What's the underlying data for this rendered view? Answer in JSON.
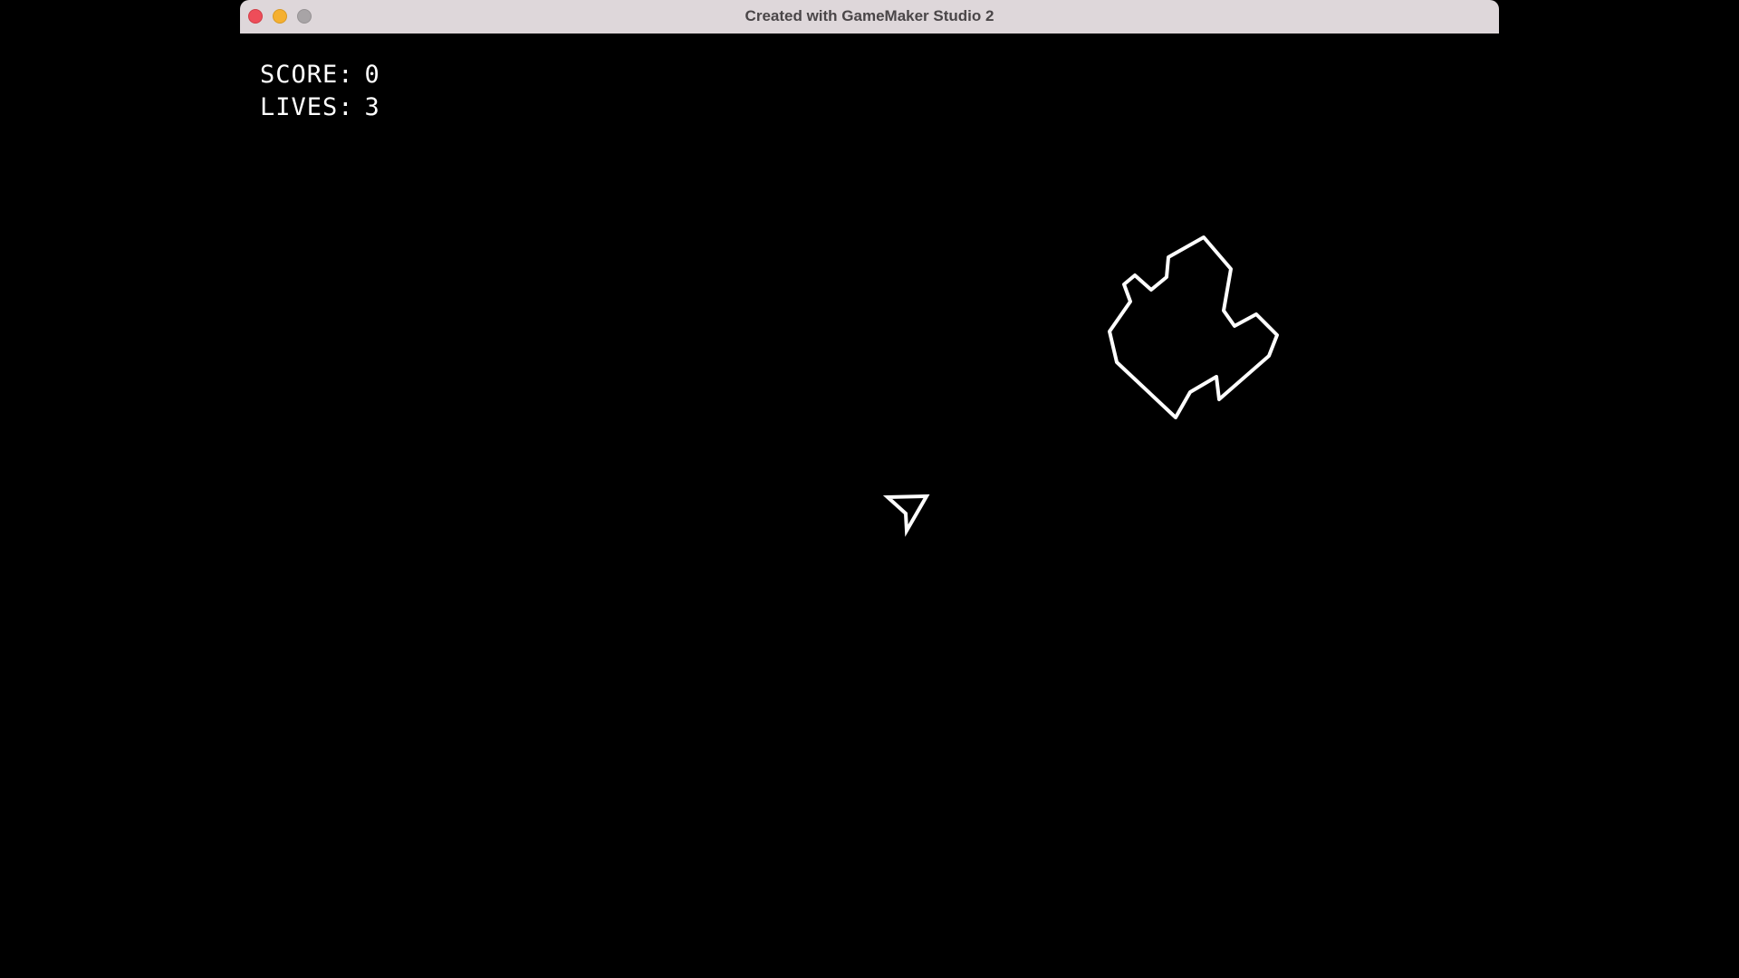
{
  "window": {
    "title": "Created with GameMaker Studio 2",
    "buttons": {
      "close_color": "#ee4d59",
      "minimize_color": "#f5b030",
      "zoom_color": "#a8a4a6"
    }
  },
  "hud": {
    "score_label": "SCORE:",
    "score_value": "0",
    "lives_label": "LIVES:",
    "lives_value": "3",
    "text_color": "#ffffff"
  },
  "scene": {
    "background_color": "#000000",
    "stroke_color": "#ffffff",
    "objects": [
      {
        "kind": "asteroid",
        "icon": "asteroid-outline-icon"
      },
      {
        "kind": "player-ship",
        "icon": "ship-arrow-icon"
      }
    ]
  }
}
